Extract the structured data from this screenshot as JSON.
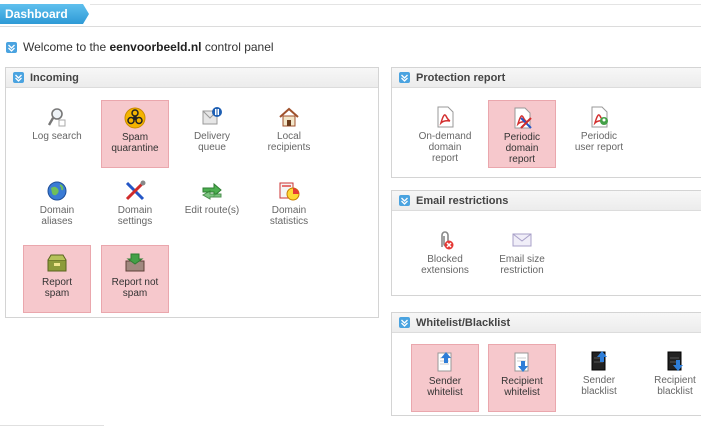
{
  "header": {
    "title": "Dashboard"
  },
  "welcome": {
    "prefix": "Welcome to the ",
    "domain": "eenvoorbeeld.nl",
    "suffix": " control panel"
  },
  "incoming": {
    "title": "Incoming",
    "items": [
      {
        "l1": "Log search",
        "l2": ""
      },
      {
        "l1": "Spam",
        "l2": "quarantine"
      },
      {
        "l1": "Delivery",
        "l2": "queue"
      },
      {
        "l1": "Local",
        "l2": "recipients"
      },
      {
        "l1": "Domain",
        "l2": "aliases"
      },
      {
        "l1": "Domain",
        "l2": "settings"
      },
      {
        "l1": "Edit route(s)",
        "l2": ""
      },
      {
        "l1": "Domain",
        "l2": "statistics"
      },
      {
        "l1": "Report",
        "l2": "spam"
      },
      {
        "l1": "Report not",
        "l2": "spam"
      }
    ]
  },
  "protection": {
    "title": "Protection report",
    "items": [
      {
        "l1": "On-demand",
        "l2": "domain",
        "l3": "report"
      },
      {
        "l1": "Periodic",
        "l2": "domain",
        "l3": "report"
      },
      {
        "l1": "Periodic",
        "l2": "user report",
        "l3": ""
      }
    ]
  },
  "email_restrictions": {
    "title": "Email restrictions",
    "items": [
      {
        "l1": "Blocked",
        "l2": "extensions"
      },
      {
        "l1": "Email size",
        "l2": "restriction"
      }
    ]
  },
  "whitelist": {
    "title": "Whitelist/Blacklist",
    "items": [
      {
        "l1": "Sender",
        "l2": "whitelist"
      },
      {
        "l1": "Recipient",
        "l2": "whitelist"
      },
      {
        "l1": "Sender",
        "l2": "blacklist"
      },
      {
        "l1": "Recipient",
        "l2": "blacklist"
      }
    ]
  },
  "colors": {
    "accent": "#35a8e0",
    "highlight": "#f6c8cc"
  }
}
